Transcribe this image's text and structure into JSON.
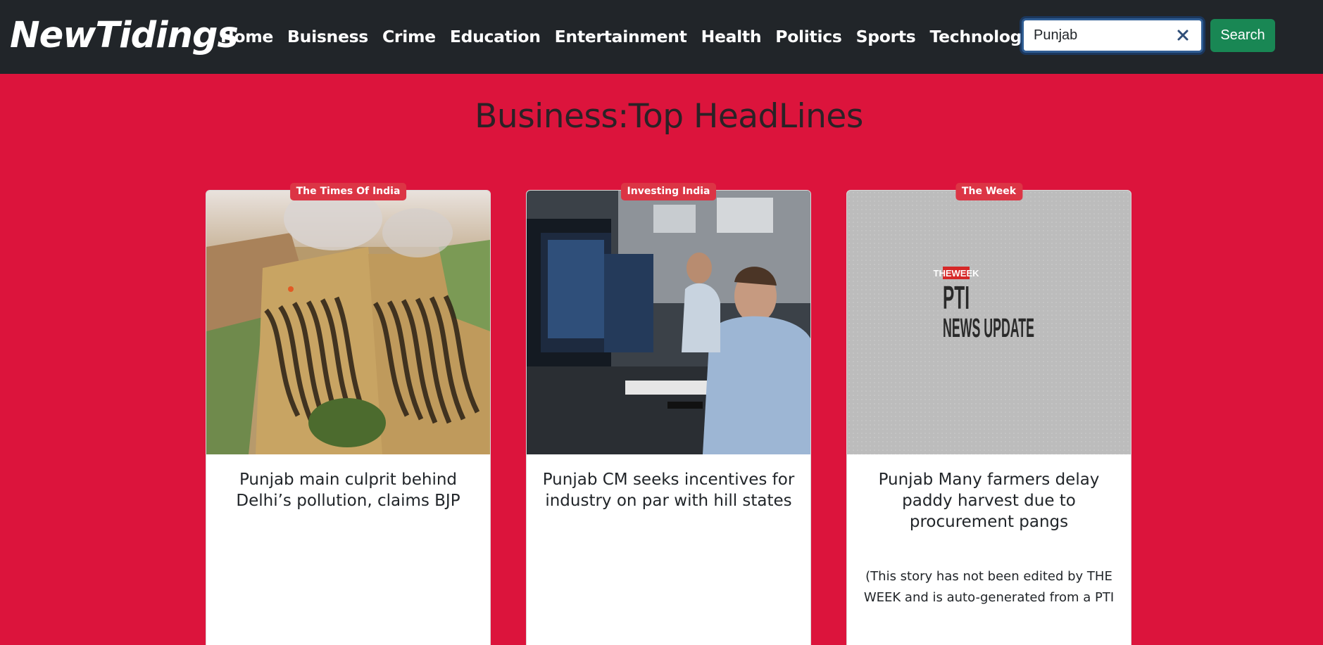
{
  "navbar": {
    "brand": "NewTidings",
    "links": [
      "Home",
      "Buisness",
      "Crime",
      "Education",
      "Entertainment",
      "Health",
      "Politics",
      "Sports",
      "Technology"
    ],
    "search": {
      "value": "Punjab",
      "button_label": "Search"
    }
  },
  "page": {
    "title": "Business:Top HeadLines"
  },
  "cards": [
    {
      "source": "The Times Of India",
      "title": "Punjab main culprit behind Delhi’s pollution, claims BJP",
      "description": ""
    },
    {
      "source": "Investing India",
      "title": "Punjab CM seeks incentives for industry on par with hill states",
      "description": ""
    },
    {
      "source": "The Week",
      "title": "Punjab Many farmers delay paddy harvest due to procurement pangs",
      "description": "(This story has not been edited by THE WEEK and is auto-generated from a PTI",
      "image_text": {
        "logo": "THEWEEK",
        "line1": "PTI",
        "line2": "NEWS UPDATE"
      }
    }
  ],
  "colors": {
    "navbar": "#212529",
    "background": "#dc143c",
    "badge": "#dc3545",
    "search_button": "#198754"
  }
}
